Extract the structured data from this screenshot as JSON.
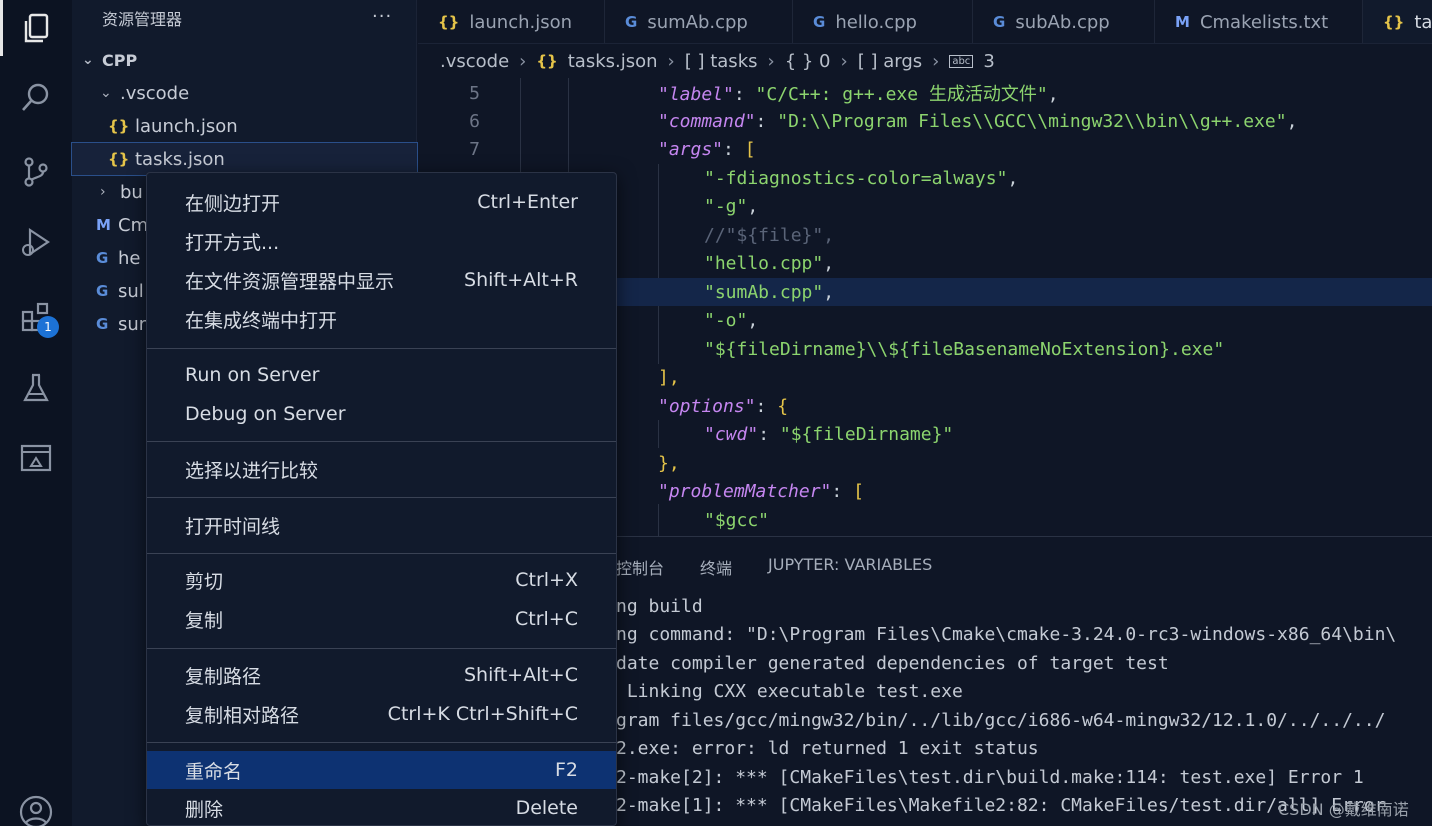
{
  "activity_bar": {
    "items": [
      {
        "name": "explorer-icon"
      },
      {
        "name": "search-icon"
      },
      {
        "name": "source-control-icon"
      },
      {
        "name": "run-debug-icon"
      },
      {
        "name": "extensions-icon"
      },
      {
        "name": "testing-icon"
      },
      {
        "name": "remote-explorer-icon"
      },
      {
        "name": "account-icon"
      }
    ],
    "extensions_badge": "1"
  },
  "sidebar": {
    "title": "资源管理器",
    "more": "···",
    "section": "CPP",
    "items": [
      {
        "label": ".vscode",
        "icon": "chevron-down-icon"
      },
      {
        "label": "launch.json",
        "icon": "json-icon"
      },
      {
        "label": "tasks.json",
        "icon": "json-icon"
      },
      {
        "label": "bu",
        "icon": "chevron-right-icon"
      },
      {
        "label": "Cm",
        "icon": "cmake-icon"
      },
      {
        "label": "he",
        "icon": "cpp-icon"
      },
      {
        "label": "sul",
        "icon": "cpp-icon"
      },
      {
        "label": "sur",
        "icon": "cpp-icon"
      }
    ]
  },
  "tabs": [
    {
      "label": "launch.json",
      "icon": "{}"
    },
    {
      "label": "sumAb.cpp",
      "icon": "G"
    },
    {
      "label": "hello.cpp",
      "icon": "G"
    },
    {
      "label": "subAb.cpp",
      "icon": "G"
    },
    {
      "label": "Cmakelists.txt",
      "icon": "M"
    },
    {
      "label": "tas",
      "icon": "{}"
    }
  ],
  "breadcrumb": {
    "folder": ".vscode",
    "file": "tasks.json",
    "tasks": "[ ] tasks",
    "index": "{ } 0",
    "args": "[ ] args",
    "item": "3"
  },
  "editor": {
    "line_numbers": [
      "5",
      "6",
      "7"
    ],
    "lines": [
      [
        "\"label\"",
        ": ",
        "\"C/C++: g++.exe 生成活动文件\"",
        ","
      ],
      [
        "\"command\"",
        ": ",
        "\"D:\\\\Program Files\\\\GCC\\\\mingw32\\\\bin\\\\g++.exe\"",
        ","
      ],
      [
        "\"args\"",
        ": ",
        "[",
        ""
      ],
      [
        "",
        "",
        "\"-fdiagnostics-color=always\"",
        ","
      ],
      [
        "",
        "",
        "\"-g\"",
        ","
      ],
      [
        "",
        "",
        "//\"${file}\",",
        ""
      ],
      [
        "",
        "",
        "\"hello.cpp\"",
        ","
      ],
      [
        "",
        "",
        "\"sumAb.cpp\"",
        ","
      ],
      [
        "",
        "",
        "\"-o\"",
        ","
      ],
      [
        "",
        "",
        "\"${fileDirname}\\\\${fileBasenameNoExtension}.exe\"",
        ""
      ],
      [
        "",
        "",
        "],",
        ""
      ],
      [
        "\"options\"",
        ": ",
        "{",
        ""
      ],
      [
        "\"cwd\"",
        ": ",
        "\"${fileDirname}\"",
        ""
      ],
      [
        "",
        "",
        "},",
        ""
      ],
      [
        "\"problemMatcher\"",
        ": ",
        "[",
        ""
      ],
      [
        "",
        "",
        "\"$gcc\"",
        ""
      ]
    ]
  },
  "panel": {
    "tabs": [
      "控制台",
      "终端",
      "JUPYTER: VARIABLES"
    ],
    "lines": [
      "ng build",
      "ng command: \"D:\\Program Files\\Cmake\\cmake-3.24.0-rc3-windows-x86_64\\bin\\",
      "date compiler generated dependencies of target test",
      " Linking CXX executable test.exe",
      "gram files/gcc/mingw32/bin/../lib/gcc/i686-w64-mingw32/12.1.0/../../../",
      "2.exe: error: ld returned 1 exit status",
      "2-make[2]: *** [CMakeFiles\\test.dir\\build.make:114: test.exe] Error 1",
      "2-make[1]: *** [CMakeFiles\\Makefile2:82: CMakeFiles/test.dir/all] Error"
    ]
  },
  "context_menu": {
    "groups": [
      [
        {
          "label": "在侧边打开",
          "shortcut": "Ctrl+Enter"
        },
        {
          "label": "打开方式...",
          "shortcut": ""
        },
        {
          "label": "在文件资源管理器中显示",
          "shortcut": "Shift+Alt+R"
        },
        {
          "label": "在集成终端中打开",
          "shortcut": ""
        }
      ],
      [
        {
          "label": "Run on Server",
          "shortcut": ""
        },
        {
          "label": "Debug on Server",
          "shortcut": ""
        }
      ],
      [
        {
          "label": "选择以进行比较",
          "shortcut": ""
        }
      ],
      [
        {
          "label": "打开时间线",
          "shortcut": ""
        }
      ],
      [
        {
          "label": "剪切",
          "shortcut": "Ctrl+X"
        },
        {
          "label": "复制",
          "shortcut": "Ctrl+C"
        }
      ],
      [
        {
          "label": "复制路径",
          "shortcut": "Shift+Alt+C"
        },
        {
          "label": "复制相对路径",
          "shortcut": "Ctrl+K Ctrl+Shift+C"
        }
      ],
      [
        {
          "label": "重命名",
          "shortcut": "F2"
        },
        {
          "label": "删除",
          "shortcut": "Delete"
        }
      ]
    ],
    "active_item": "重命名"
  },
  "watermark": "CSDN @戴维南诺"
}
